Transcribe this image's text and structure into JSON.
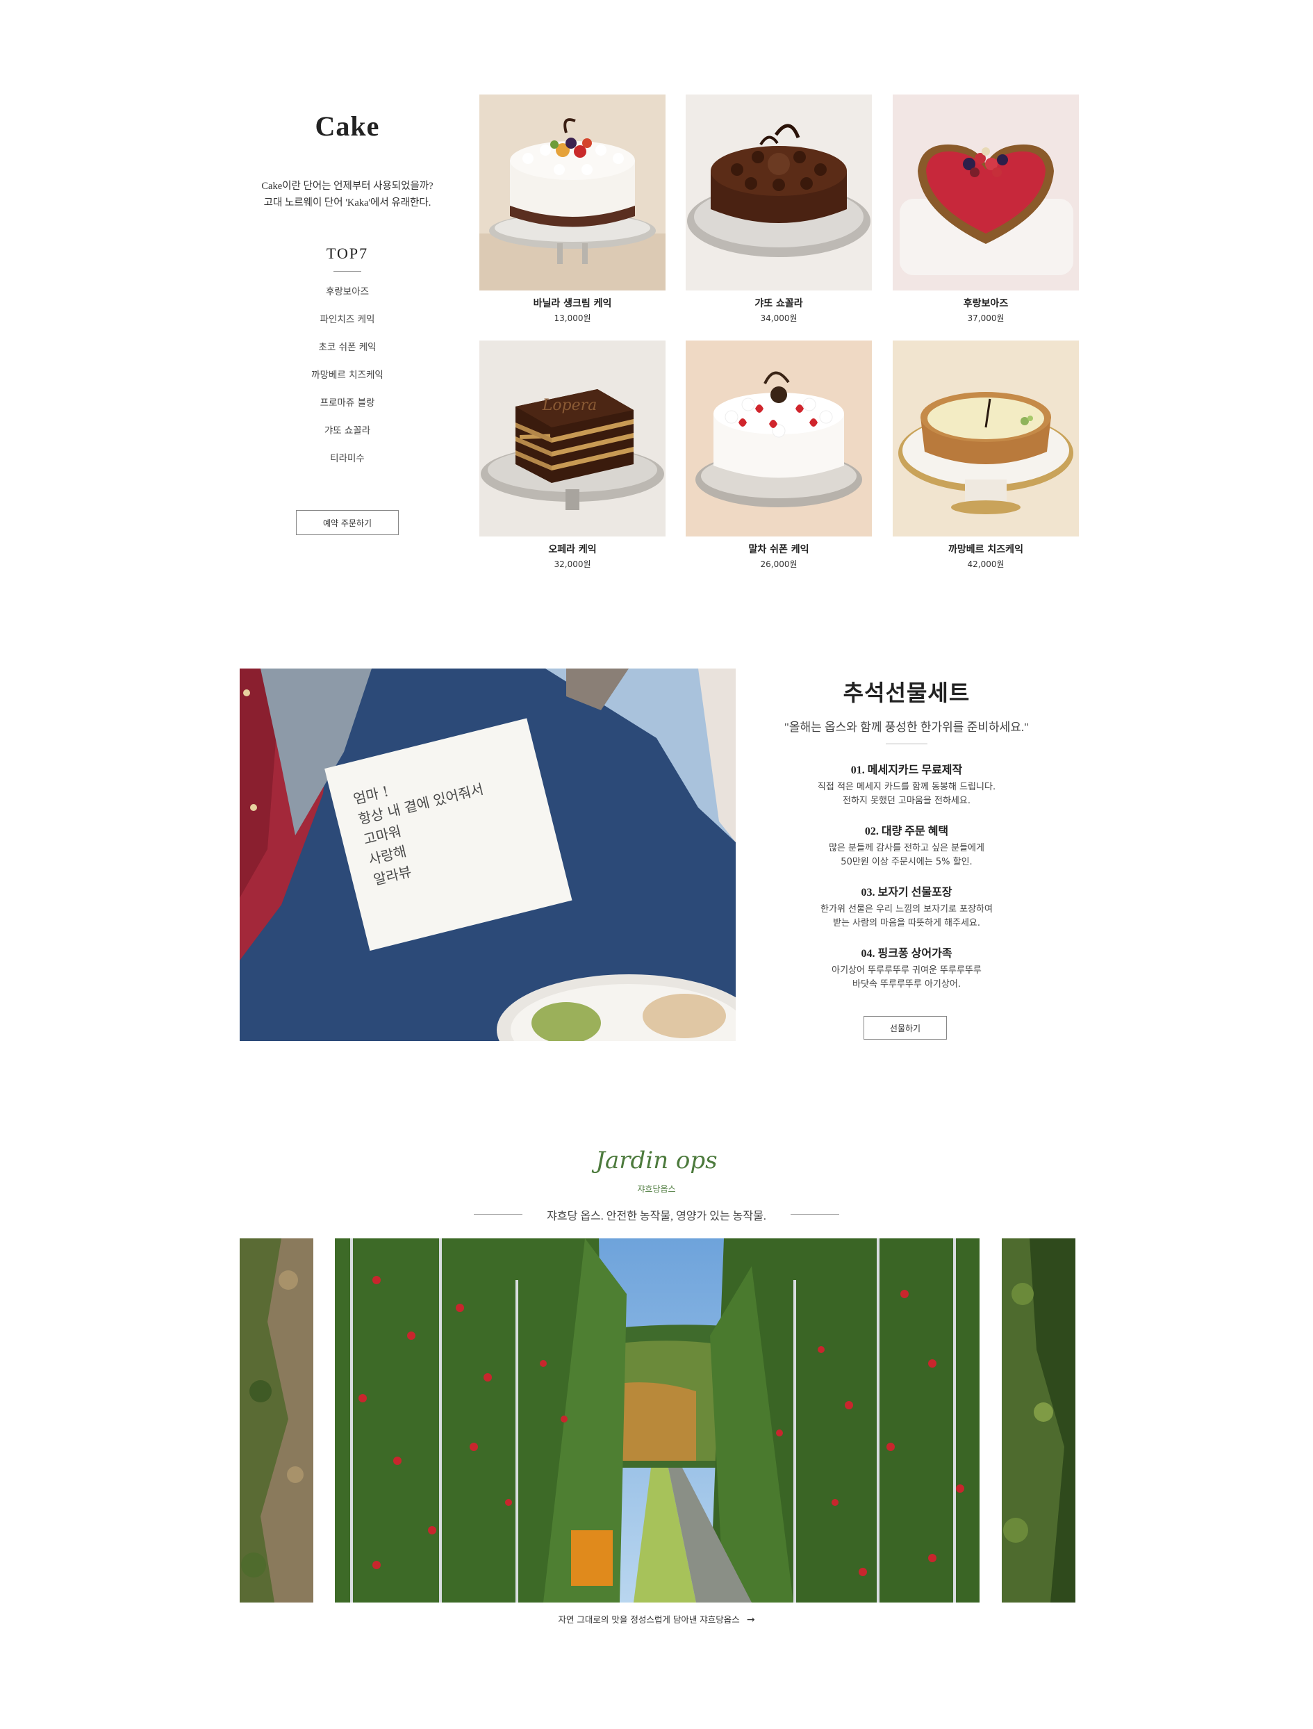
{
  "cake": {
    "title": "Cake",
    "desc_line1": "Cake이란 단어는 언제부터 사용되었을까?",
    "desc_line2": "고대 노르웨이 단어 'Kaka'에서 유래한다.",
    "top7_title": "TOP7",
    "top7": [
      "후랑보아즈",
      "파인치즈 케익",
      "초코 쉬폰 케익",
      "까망베르 치즈케익",
      "프로마쥬 블랑",
      "갸또 쇼꼴라",
      "티라미수"
    ],
    "reserve_label": "예약 주문하기",
    "products": [
      {
        "name": "바닐라 생크림 케익",
        "price": "13,000원"
      },
      {
        "name": "갸또 쇼꼴라",
        "price": "34,000원"
      },
      {
        "name": "후랑보아즈",
        "price": "37,000원"
      },
      {
        "name": "오페라 케익",
        "price": "32,000원"
      },
      {
        "name": "말차 쉬폰 케익",
        "price": "26,000원"
      },
      {
        "name": "까망베르 치즈케익",
        "price": "42,000원"
      }
    ],
    "opera_script": "Lopera"
  },
  "chuseok": {
    "title": "추석선물세트",
    "quote": "\"올해는 옵스와 함께 풍성한 한가위를 준비하세요.\"",
    "card_lines": [
      "엄마 !",
      "항상 내 곁에 있어줘서",
      "고마워",
      "사랑해",
      "알라뷰"
    ],
    "benefits": [
      {
        "title": "01. 메세지카드 무료제작",
        "lines": [
          "직접 적은 메세지 카드를 함께 동봉해 드립니다.",
          "전하지 못했던 고마움을 전하세요."
        ]
      },
      {
        "title": "02. 대량 주문 혜택",
        "lines": [
          "많은 분들께 감사를 전하고 싶은 분들에게",
          "50만원 이상 주문시에는 5% 할인."
        ]
      },
      {
        "title": "03. 보자기 선물포장",
        "lines": [
          "한가위 선물은 우리 느낌의 보자기로 포장하여",
          "받는 사람의 마음을 따뜻하게 해주세요."
        ]
      },
      {
        "title": "04. 핑크퐁 상어가족",
        "lines": [
          "아기상어 뚜루루뚜루 귀여운 뚜루루뚜루",
          "바닷속 뚜루루뚜루 아기상어."
        ]
      }
    ],
    "gift_label": "선물하기"
  },
  "jardin": {
    "logo": "Jardin ops",
    "logo_sub": "쟈흐당옵스",
    "tagline": "쟈흐당 옵스. 안전한 농작물, 영양가 있는 농작물.",
    "link_text": "자연 그대로의 맛을 정성스럽게 담아낸 쟈흐당옵스"
  },
  "icons": {
    "prev": "chevron-left-icon",
    "next": "chevron-right-icon",
    "link_arrow": "arrow-right-icon"
  },
  "colors": {
    "jardin_green": "#4c7a3c",
    "card_navy": "#2c4a78",
    "cloth_red": "#a3283a"
  }
}
